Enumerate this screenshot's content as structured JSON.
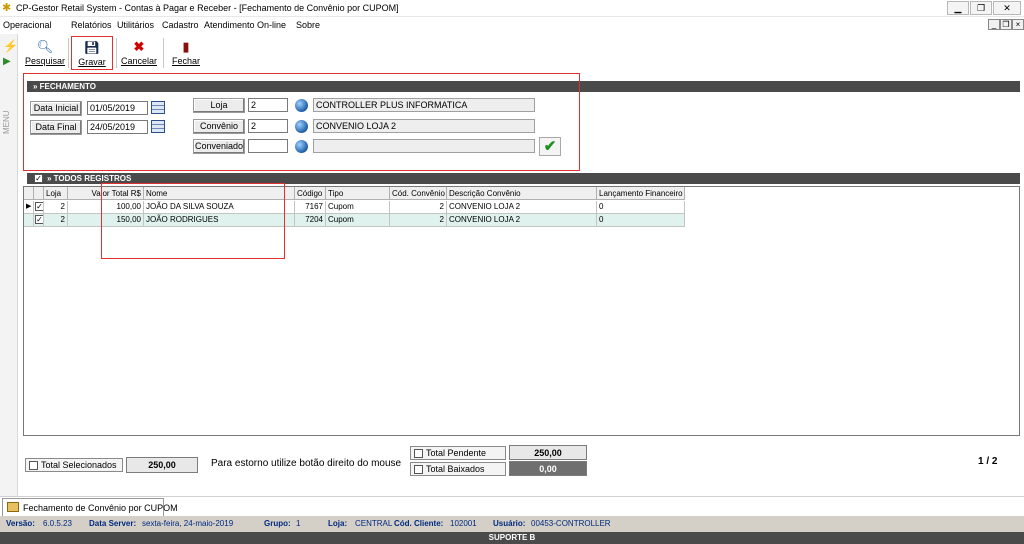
{
  "window": {
    "title": "CP-Gestor Retail System - Contas à Pagar e Receber - [Fechamento de Convênio por CUPOM]",
    "mdi_controls": [
      "_",
      "5",
      "x"
    ]
  },
  "menu": [
    "Operacional",
    "Relatórios",
    "Utilitários",
    "Cadastro",
    "Atendimento On-line",
    "Sobre"
  ],
  "toolbar": {
    "pesquisar": "Pesquisar",
    "gravar": "Gravar",
    "cancelar": "Cancelar",
    "fechar": "Fechar"
  },
  "left_strip_label": "MENU",
  "fechamento": {
    "section_title": "» FECHAMENTO",
    "data_inicial_label": "Data Inicial",
    "data_inicial": "01/05/2019",
    "data_final_label": "Data Final",
    "data_final": "24/05/2019",
    "loja_label": "Loja",
    "loja_code": "2",
    "loja_name": "CONTROLLER PLUS INFORMATICA",
    "convenio_label": "Convênio",
    "convenio_code": "2",
    "convenio_name": "CONVENIO LOJA 2",
    "conveniado_label": "Conveniado",
    "conveniado_code": "",
    "conveniado_name": ""
  },
  "registros": {
    "section_title": "» TODOS REGISTROS",
    "columns": [
      "",
      "Loja",
      "Valor Total R$",
      "Nome",
      "Código",
      "Tipo",
      "Cód. Convênio",
      "Descrição Convênio",
      "Lançamento Financeiro"
    ],
    "rows": [
      {
        "loja": "2",
        "valor": "100,00",
        "nome": "JOÃO DA SILVA SOUZA",
        "codigo": "7167",
        "tipo": "Cupom",
        "cod_convenio": "2",
        "descricao": "CONVENIO LOJA 2",
        "lancamento": "0"
      },
      {
        "loja": "2",
        "valor": "150,00",
        "nome": "JOÃO RODRIGUES",
        "codigo": "7204",
        "tipo": "Cupom",
        "cod_convenio": "2",
        "descricao": "CONVENIO LOJA 2",
        "lancamento": "0"
      }
    ]
  },
  "footer": {
    "total_selecionados_label": "Total Selecionados",
    "total_selecionados": "250,00",
    "hint": "Para estorno utilize botão direito do mouse",
    "total_pendente_label": "Total Pendente",
    "total_pendente": "250,00",
    "total_baixados_label": "Total Baixados",
    "total_baixados": "0,00",
    "page": "1 / 2"
  },
  "doc_tab": "Fechamento de Convênio por CUPOM",
  "status": {
    "versao_label": "Versão:",
    "versao": "6.0.5.23",
    "server_label": "Data Server:",
    "server": "sexta-feira, 24-maio-2019",
    "grupo_label": "Grupo:",
    "grupo": "1",
    "loja_label": "Loja:",
    "loja": "CENTRAL",
    "cliente_label": "Cód. Cliente:",
    "cliente": "102001",
    "usuario_label": "Usuário:",
    "usuario": "00453-CONTROLLER"
  },
  "support_label": "SUPORTE B",
  "colors": {
    "highlight": "#e03030",
    "row_selected": "#dff2ee",
    "section_bar": "#4a4a4a",
    "status_text": "#002a80"
  }
}
